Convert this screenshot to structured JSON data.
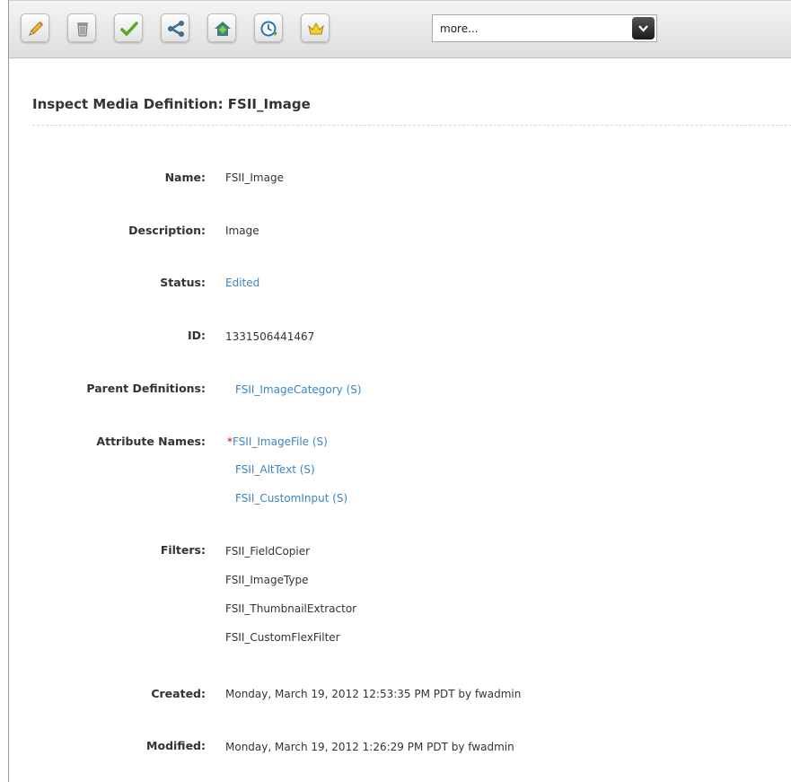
{
  "toolbar": {
    "buttons": [
      {
        "name": "edit-button",
        "icon": "pencil-icon"
      },
      {
        "name": "delete-button",
        "icon": "trash-icon"
      },
      {
        "name": "approve-button",
        "icon": "checkmark-icon"
      },
      {
        "name": "share-button",
        "icon": "share-icon"
      },
      {
        "name": "bookmark-button",
        "icon": "add-bookmark-icon"
      },
      {
        "name": "history-button",
        "icon": "clock-icon"
      },
      {
        "name": "tracker-button",
        "icon": "crown-icon"
      }
    ],
    "more_select": {
      "value": "more..."
    }
  },
  "page": {
    "title": "Inspect Media Definition: FSII_Image"
  },
  "fields": {
    "name": {
      "label": "Name:",
      "value": "FSII_Image"
    },
    "description": {
      "label": "Description:",
      "value": "Image"
    },
    "status": {
      "label": "Status:",
      "value": "Edited"
    },
    "id": {
      "label": "ID:",
      "value": "1331506441467"
    },
    "parent_definitions": {
      "label": "Parent Definitions:",
      "values": [
        "FSII_ImageCategory (S)"
      ]
    },
    "attribute_names": {
      "label": "Attribute Names:",
      "required_marker": "*",
      "values": [
        "FSII_ImageFile (S)",
        "FSII_AltText (S)",
        "FSII_CustomInput (S)"
      ]
    },
    "filters": {
      "label": "Filters:",
      "values": [
        "FSII_FieldCopier",
        "FSII_ImageType",
        "FSII_ThumbnailExtractor",
        "FSII_CustomFlexFilter"
      ]
    },
    "created": {
      "label": "Created:",
      "value": "Monday, March 19, 2012 12:53:35 PM PDT by fwadmin"
    },
    "modified": {
      "label": "Modified:",
      "value": "Monday, March 19, 2012 1:26:29 PM PDT by fwadmin"
    }
  },
  "colors": {
    "link": "#3b86c2",
    "required": "#dd0000"
  }
}
